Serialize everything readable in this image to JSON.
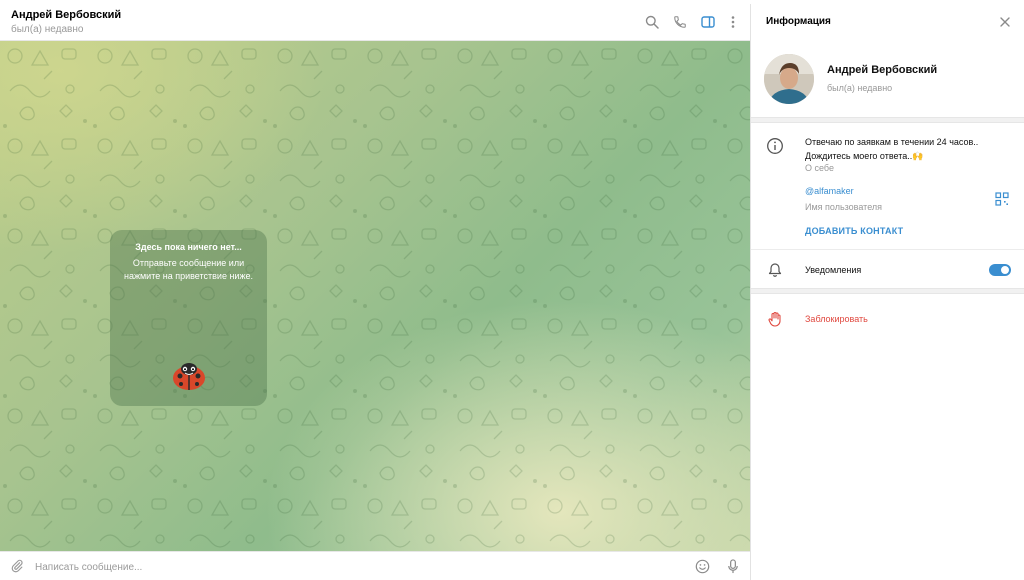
{
  "chat": {
    "title": "Андрей Вербовский",
    "status": "был(а) недавно",
    "header_icons": [
      "search-icon",
      "phone-icon",
      "sidebar-toggle-icon",
      "more-vertical-icon"
    ],
    "empty": {
      "title": "Здесь пока ничего нет...",
      "text": "Отправьте сообщение или нажмите на приветствие ниже."
    },
    "composer": {
      "placeholder": "Написать сообщение...",
      "icons": [
        "attach-icon",
        "emoji-icon",
        "microphone-icon"
      ]
    }
  },
  "panel": {
    "title": "Информация",
    "profile": {
      "name": "Андрей Вербовский",
      "status": "был(а) недавно"
    },
    "bio": {
      "text": "Отвечаю по заявкам в течении 24 часов.. Дождитесь моего ответа..🙌",
      "label": "О себе"
    },
    "username": {
      "value": "@alfamaker",
      "label": "Имя пользователя"
    },
    "add_contact": "ДОБАВИТЬ КОНТАКТ",
    "notifications": {
      "label": "Уведомления",
      "enabled": true
    },
    "block": "Заблокировать"
  },
  "colors": {
    "accent": "#3a8ed0",
    "danger": "#e0483f",
    "muted": "#999999",
    "chat_bg_start": "#bccd8a",
    "chat_bg_end": "#8fbc8c"
  }
}
